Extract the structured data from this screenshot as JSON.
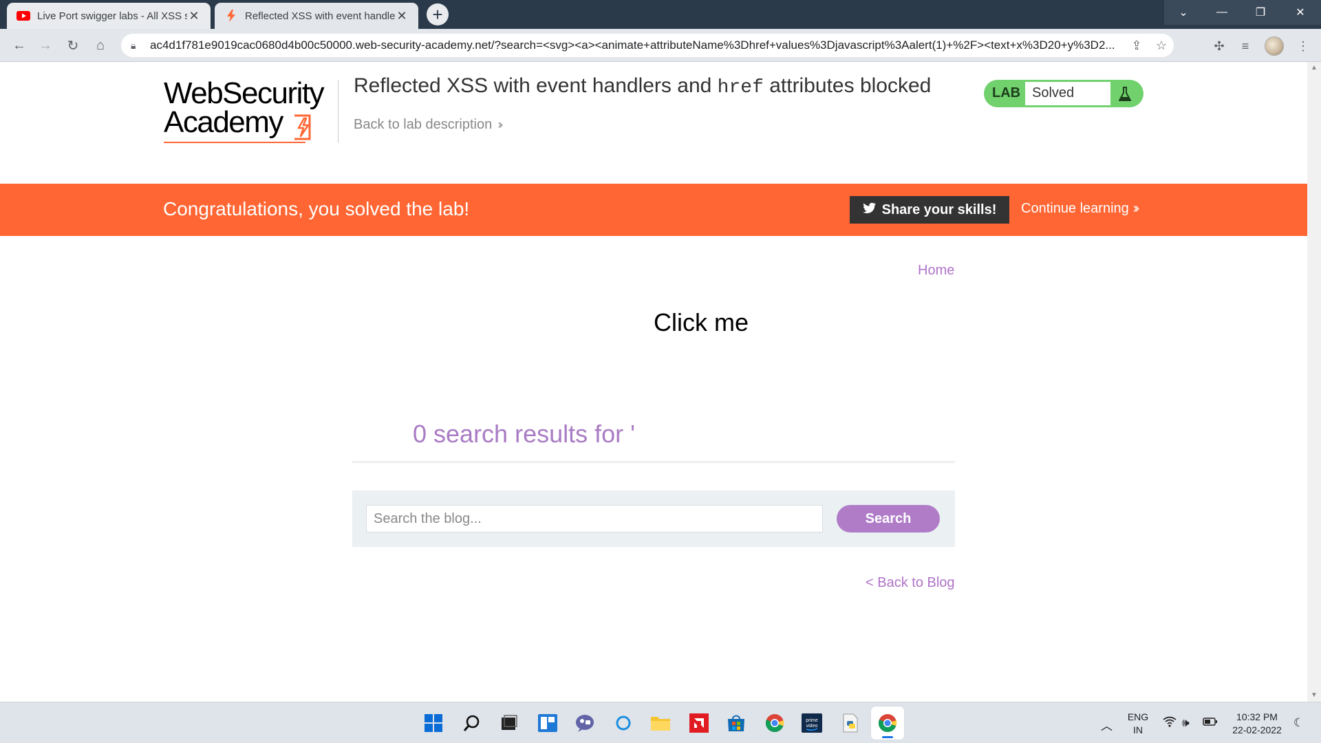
{
  "browser": {
    "tabs": [
      {
        "title": "Live Port swigger labs - All XSS sc",
        "active": false,
        "favicon": "youtube-icon"
      },
      {
        "title": "Reflected XSS with event handler",
        "active": true,
        "favicon": "portswigger-icon"
      }
    ],
    "url": "ac4d1f781e9019cac0680d4b00c50000.web-security-academy.net/?search=<svg><a><animate+attributeName%3Dhref+values%3Djavascript%3Aalert(1)+%2F><text+x%3D20+y%3D2..."
  },
  "header": {
    "logo_line1": "WebSecurity",
    "logo_line2": "Academy",
    "title_before": "Reflected XSS with event handlers and ",
    "title_code": "href",
    "title_after": " attributes blocked",
    "back_link": "Back to lab description",
    "lab_badge": "LAB",
    "lab_state": "Solved"
  },
  "banner": {
    "message": "Congratulations, you solved the lab!",
    "share_label": "Share your skills!",
    "continue_label": "Continue learning"
  },
  "main": {
    "home_link": "Home",
    "click_me": "Click me",
    "results_text": "0 search results for '",
    "search_placeholder": "Search the blog...",
    "search_button": "Search",
    "back_to_blog": "< Back to Blog"
  },
  "taskbar": {
    "lang_line1": "ENG",
    "lang_line2": "IN",
    "time": "10:32 PM",
    "date": "22-02-2022"
  },
  "colors": {
    "accent_orange": "#ff6633",
    "link_purple": "#b073c7",
    "lab_green": "#70d16d",
    "search_purple": "#b07cc8"
  }
}
